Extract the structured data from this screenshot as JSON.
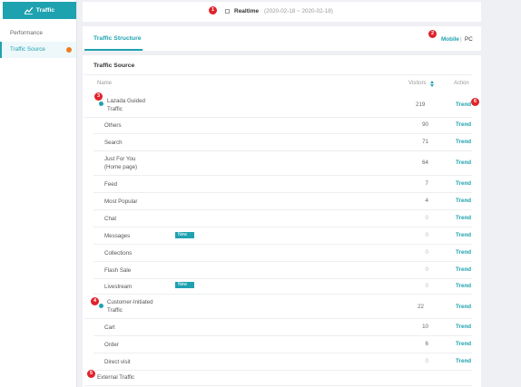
{
  "sidebar": {
    "header": "Traffic",
    "items": [
      {
        "label": "Performance"
      },
      {
        "label": "Traffic Source"
      }
    ]
  },
  "topbar": {
    "mode": "Realtime",
    "date_range": "(2020-02-18 ~ 2020-02-18)"
  },
  "tabs": {
    "active": "Traffic Structure",
    "device_mobile": "Mobile",
    "separator": "|",
    "device_pc": "PC"
  },
  "table": {
    "title": "Traffic Source",
    "headers": {
      "name": "Name",
      "visitors": "Visitors",
      "action": "Action"
    },
    "sort_icon": "sort-arrows-icon",
    "new_tag": "New",
    "rows": [
      {
        "name": "Lazada Guided Traffic",
        "visitors": "219",
        "action": "Trend"
      },
      {
        "name": "Others",
        "visitors": "90",
        "action": "Trend"
      },
      {
        "name": "Search",
        "visitors": "71",
        "action": "Trend"
      },
      {
        "name": "Just For You (Home page)",
        "visitors": "64",
        "action": "Trend"
      },
      {
        "name": "Feed",
        "visitors": "7",
        "action": "Trend"
      },
      {
        "name": "Most Popular",
        "visitors": "4",
        "action": "Trend"
      },
      {
        "name": "Chat",
        "visitors": "0",
        "action": "Trend"
      },
      {
        "name": "Messages",
        "visitors": "0",
        "action": "Trend"
      },
      {
        "name": "Collections",
        "visitors": "0",
        "action": "Trend"
      },
      {
        "name": "Flash Sale",
        "visitors": "0",
        "action": "Trend"
      },
      {
        "name": "Livestream",
        "visitors": "0",
        "action": "Trend"
      },
      {
        "name": "Customer-Initiated Traffic",
        "visitors": "22",
        "action": "Trend"
      },
      {
        "name": "Cart",
        "visitors": "10",
        "action": "Trend"
      },
      {
        "name": "Order",
        "visitors": "6",
        "action": "Trend"
      },
      {
        "name": "Direct visit",
        "visitors": "0",
        "action": "Trend"
      },
      {
        "name": "External Traffic",
        "visitors": "",
        "action": ""
      }
    ]
  },
  "markers": [
    "1",
    "2",
    "3",
    "4",
    "5",
    "6"
  ],
  "colors": {
    "accent": "#1fa2b0",
    "marker": "#e0232b",
    "notice": "#f07c22"
  }
}
